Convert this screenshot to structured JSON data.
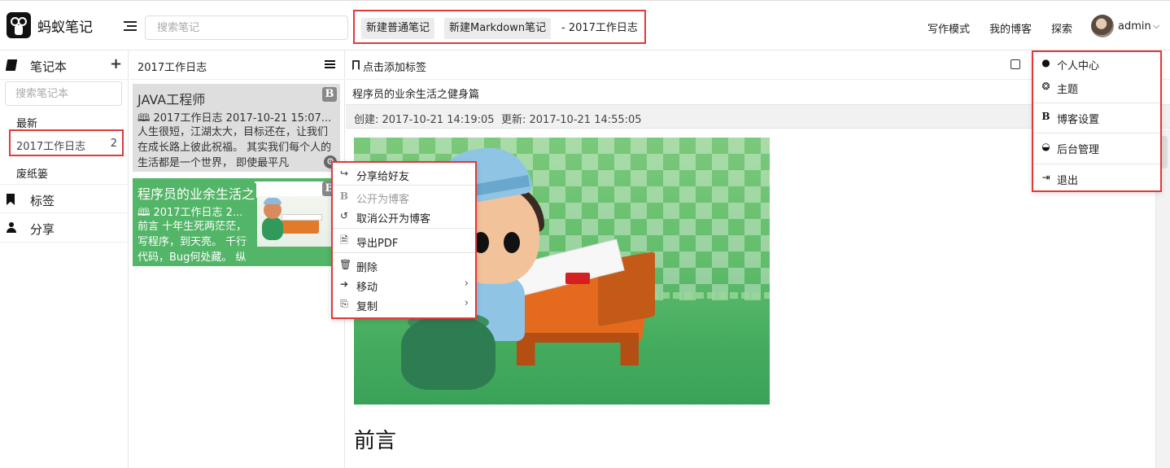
{
  "app": {
    "name": "蚂蚁笔记"
  },
  "header": {
    "search_placeholder": "搜索笔记",
    "new_note_label": "新建普通笔记",
    "new_markdown_label": "新建Markdown笔记",
    "new_context": "- 2017工作日志",
    "nav": [
      "写作模式",
      "我的博客",
      "探索"
    ],
    "username": "admin"
  },
  "sidebar": {
    "notebooks_label": "笔记本",
    "search_placeholder": "搜索笔记本",
    "recent_label": "最新",
    "selected_notebook": {
      "label": "2017工作日志",
      "count": "2"
    },
    "trash_label": "废纸篓",
    "tags_label": "标签",
    "share_label": "分享"
  },
  "note_list": {
    "header": "2017工作日志",
    "notes": [
      {
        "title": "JAVA工程师",
        "meta": "2017工作日志 2017-10-21 15:07...",
        "desc": "人生很短，江湖太大，目标还在，让我们在成长路上彼此祝福。 其实我们每个人的生活都是一个世界， 即使最平凡"
      },
      {
        "title": "程序员的业余生活之",
        "meta": "2017工作日志 2...",
        "desc": "前言 十年生死两茫茫，写程序，到天亮。 千行代码，Bug何处藏。 纵"
      }
    ],
    "blog_badge": "B"
  },
  "editor": {
    "tag_placeholder": "点击添加标签",
    "title": "程序员的业余生活之健身篇",
    "created": "创建: 2017-10-21 14:19:05",
    "updated": "更新: 2017-10-21 14:55:05",
    "heading": "前言"
  },
  "context_menu": {
    "items": [
      {
        "label": "分享给好友",
        "icon": "share-icon",
        "enabled": true
      },
      {
        "label": "公开为博客",
        "icon": "blog-icon",
        "enabled": false
      },
      {
        "label": "取消公开为博客",
        "icon": "undo-icon",
        "enabled": true
      },
      {
        "label": "导出PDF",
        "icon": "pdf-icon",
        "enabled": true
      },
      {
        "label": "删除",
        "icon": "trash-icon",
        "enabled": true
      },
      {
        "label": "移动",
        "icon": "arrow-right-icon",
        "enabled": true,
        "submenu": true
      },
      {
        "label": "复制",
        "icon": "copy-icon",
        "enabled": true,
        "submenu": true
      }
    ]
  },
  "user_menu": {
    "items": [
      {
        "label": "个人中心",
        "icon": "user-icon"
      },
      {
        "label": "主题",
        "icon": "theme-icon"
      },
      {
        "label": "博客设置",
        "icon": "blog-settings-icon"
      },
      {
        "label": "后台管理",
        "icon": "dashboard-icon"
      },
      {
        "label": "退出",
        "icon": "logout-icon"
      }
    ]
  },
  "colors": {
    "highlight_border": "#e03a3a",
    "selected_note_bg": "#52b567",
    "note_card_bg": "#dedede"
  }
}
